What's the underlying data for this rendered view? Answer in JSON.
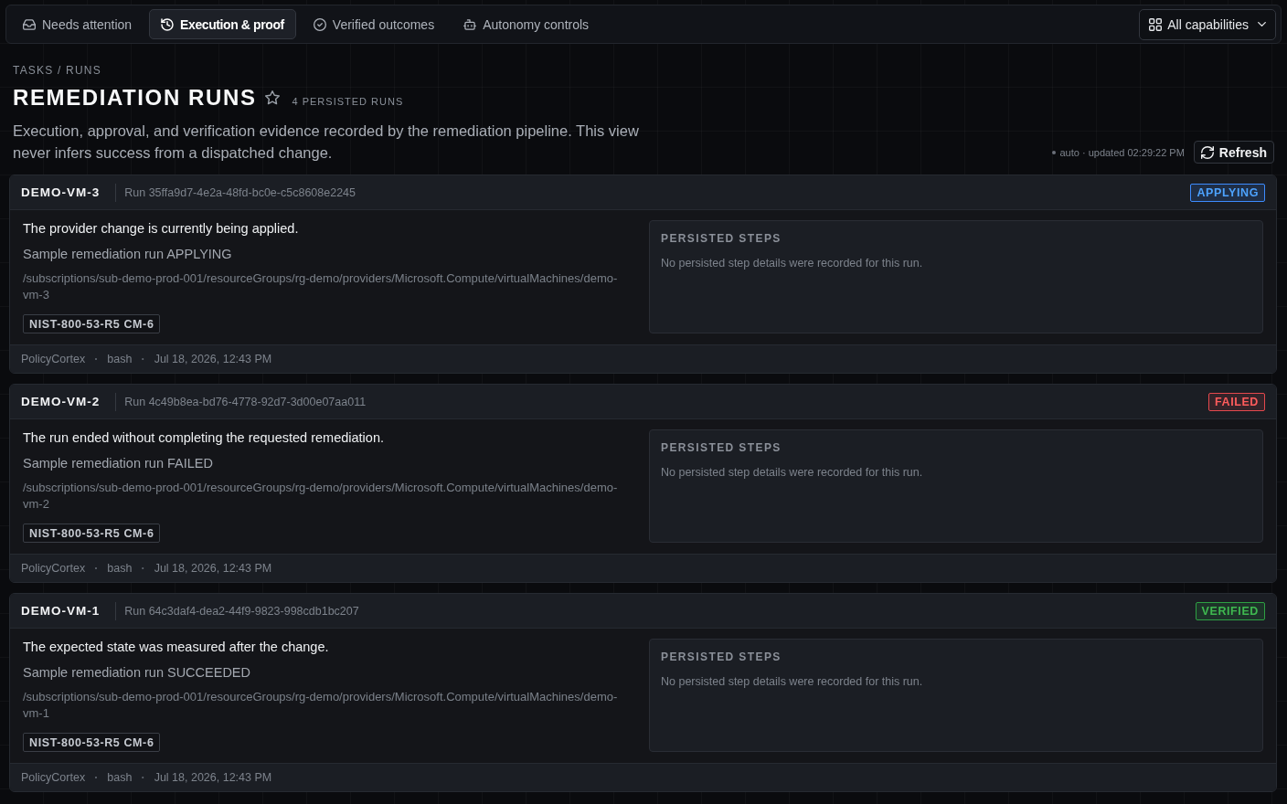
{
  "nav": {
    "tabs": [
      {
        "label": "Needs attention",
        "selected": false
      },
      {
        "label": "Execution & proof",
        "selected": true
      },
      {
        "label": "Verified outcomes",
        "selected": false
      },
      {
        "label": "Autonomy controls",
        "selected": false
      }
    ],
    "filter": {
      "label": "All capabilities"
    }
  },
  "header": {
    "breadcrumb": "TASKS / RUNS",
    "title": "REMEDIATION RUNS",
    "starred": false,
    "count": "4 PERSISTED RUNS",
    "description": "Execution, approval, and verification evidence recorded by the remediation pipeline. This view never infers success from a dispatched change.",
    "sync_status": "auto · updated 02:29:22 PM",
    "refresh": "Refresh"
  },
  "runs": [
    {
      "name": "DEMO-VM-3",
      "run_id": "Run 35ffa9d7-4e2a-48fd-bc0e-c5c8608e2245",
      "status": {
        "label": "APPLYING",
        "kind": "applying"
      },
      "summary": "The provider change is currently being applied.",
      "detail": "Sample remediation run APPLYING",
      "resource": "/subscriptions/sub-demo-prod-001/resourceGroups/rg-demo/providers/Microsoft.Compute/virtualMachines/demo-vm-3",
      "control": "NIST-800-53-R5 CM-6",
      "steps": {
        "heading": "PERSISTED STEPS",
        "empty": "No persisted step details were recorded for this run."
      },
      "footer": [
        {
          "kind": "text",
          "text": "PolicyCortex"
        },
        {
          "kind": "separator",
          "text": "·"
        },
        {
          "kind": "text",
          "text": "bash"
        },
        {
          "kind": "separator",
          "text": "·"
        },
        {
          "kind": "text",
          "text": "Jul 18, 2026, 12:43 PM"
        }
      ]
    },
    {
      "name": "DEMO-VM-2",
      "run_id": "Run 4c49b8ea-bd76-4778-92d7-3d00e07aa011",
      "status": {
        "label": "FAILED",
        "kind": "failed"
      },
      "summary": "The run ended without completing the requested remediation.",
      "detail": "Sample remediation run FAILED",
      "resource": "/subscriptions/sub-demo-prod-001/resourceGroups/rg-demo/providers/Microsoft.Compute/virtualMachines/demo-vm-2",
      "control": "NIST-800-53-R5 CM-6",
      "steps": {
        "heading": "PERSISTED STEPS",
        "empty": "No persisted step details were recorded for this run."
      },
      "footer": [
        {
          "kind": "text",
          "text": "PolicyCortex"
        },
        {
          "kind": "separator",
          "text": "·"
        },
        {
          "kind": "text",
          "text": "bash"
        },
        {
          "kind": "separator",
          "text": "·"
        },
        {
          "kind": "text",
          "text": "Jul 18, 2026, 12:43 PM"
        }
      ]
    },
    {
      "name": "DEMO-VM-1",
      "run_id": "Run 64c3daf4-dea2-44f9-9823-998cdb1bc207",
      "status": {
        "label": "VERIFIED",
        "kind": "verified"
      },
      "summary": "The expected state was measured after the change.",
      "detail": "Sample remediation run SUCCEEDED",
      "resource": "/subscriptions/sub-demo-prod-001/resourceGroups/rg-demo/providers/Microsoft.Compute/virtualMachines/demo-vm-1",
      "control": "NIST-800-53-R5 CM-6",
      "steps": {
        "heading": "PERSISTED STEPS",
        "empty": "No persisted step details were recorded for this run."
      },
      "footer": [
        {
          "kind": "text",
          "text": "PolicyCortex"
        },
        {
          "kind": "separator",
          "text": "·"
        },
        {
          "kind": "text",
          "text": "bash"
        },
        {
          "kind": "separator",
          "text": "·"
        },
        {
          "kind": "text",
          "text": "Jul 18, 2026, 12:43 PM"
        }
      ]
    }
  ]
}
